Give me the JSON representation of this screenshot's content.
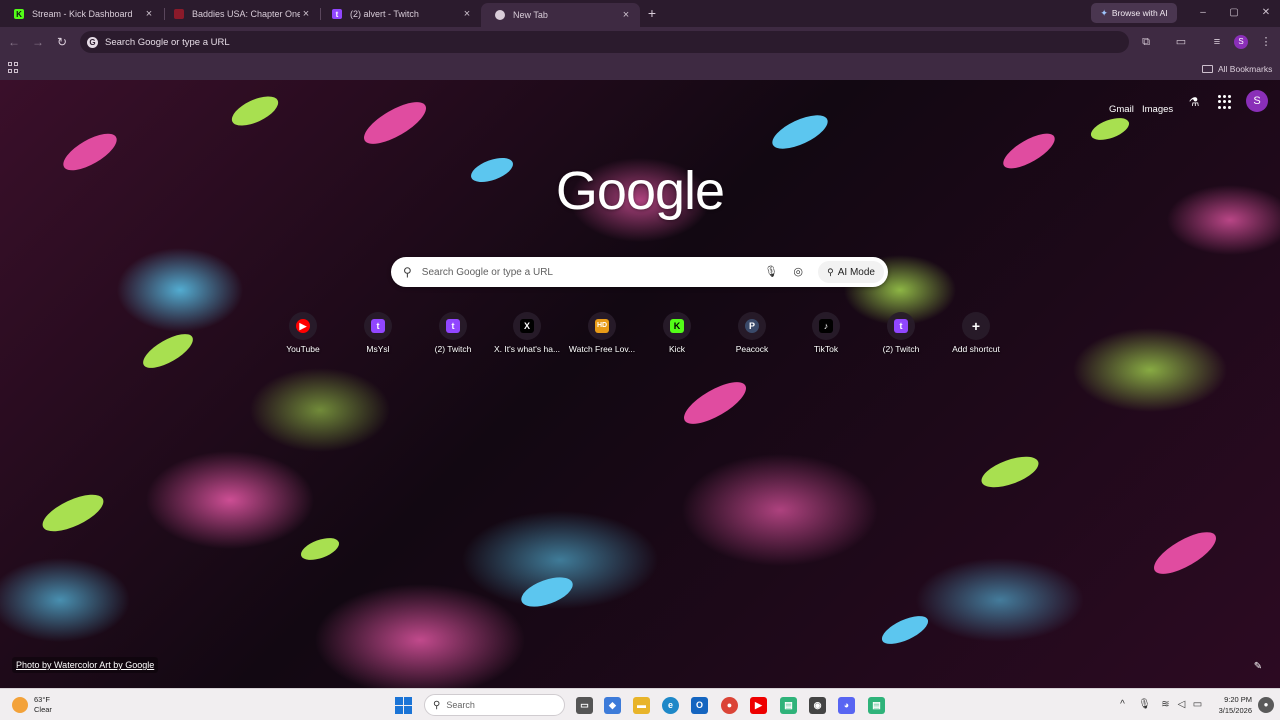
{
  "colors": {
    "kick_green": "#53fc18",
    "twitch_purple": "#9146ff",
    "youtube_red": "#ff0000",
    "profile_purple": "#8a2fb8"
  },
  "tabs": [
    {
      "title": "Stream - Kick Dashboard",
      "icon": "kick-icon"
    },
    {
      "title": "Baddies USA: Chapter One Epis",
      "icon": "video-icon"
    },
    {
      "title": "(2) alvert - Twitch",
      "icon": "twitch-icon"
    },
    {
      "title": "New Tab",
      "icon": "chrome-icon"
    }
  ],
  "toolbar": {
    "browse_ai": "Browse with AI",
    "omnibox_text": "Search Google or type a URL",
    "profile_initial": "S"
  },
  "bookmarks": {
    "all_bookmarks": "All Bookmarks"
  },
  "ntp": {
    "gmail": "Gmail",
    "images": "Images",
    "account_initial": "S",
    "logo": "Google",
    "search_placeholder": "Search Google or type a URL",
    "ai_mode": "AI Mode",
    "shortcuts": [
      {
        "label": "YouTube",
        "glyph": "▶",
        "icon": "youtube-icon"
      },
      {
        "label": "MsYsl",
        "glyph": "t",
        "icon": "twitch-icon"
      },
      {
        "label": "(2) Twitch",
        "glyph": "t",
        "icon": "twitch-icon"
      },
      {
        "label": "X. It's what's ha...",
        "glyph": "X",
        "icon": "x-icon"
      },
      {
        "label": "Watch Free Lov...",
        "glyph": "HD",
        "icon": "hd-icon"
      },
      {
        "label": "Kick",
        "glyph": "K",
        "icon": "kick-icon"
      },
      {
        "label": "Peacock",
        "glyph": "P",
        "icon": "peacock-icon"
      },
      {
        "label": "TikTok",
        "glyph": "♪",
        "icon": "tiktok-icon"
      },
      {
        "label": "(2) Twitch",
        "glyph": "t",
        "icon": "twitch-icon"
      },
      {
        "label": "Add shortcut",
        "glyph": "+",
        "icon": "plus-icon"
      }
    ],
    "credit": "Photo by Watercolor Art by Google"
  },
  "taskbar": {
    "temp": "63°F",
    "condition": "Clear",
    "search_placeholder": "Search",
    "time": "9:20 PM",
    "date": "3/15/2026"
  }
}
